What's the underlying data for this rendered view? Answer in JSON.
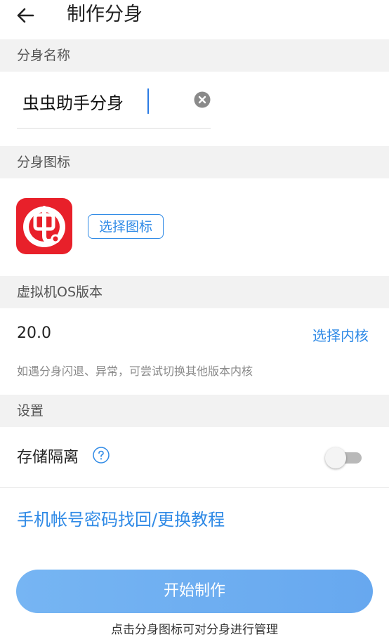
{
  "header": {
    "title": "制作分身",
    "back_icon": "arrow-left-icon"
  },
  "sections": {
    "name": "分身名称",
    "icon": "分身图标",
    "os_version": "虚拟机OS版本",
    "settings": "设置"
  },
  "name_field": {
    "value": "虫虫助手分身",
    "clear_icon": "close-circle-icon"
  },
  "icon_picker": {
    "app_icon_glyph": "虫",
    "button_label": "选择图标"
  },
  "os": {
    "version_value": "20.0",
    "choose_kernel_label": "选择内核",
    "hint": "如遇分身闪退、异常，可尝试切换其他版本内核"
  },
  "settings": {
    "storage_isolation_label": "存储隔离",
    "storage_isolation_enabled": false,
    "help_icon": "question-circle-icon"
  },
  "tutorial_link": "手机帐号密码找回/更换教程",
  "start_button": "开始制作",
  "footer_hint": "点击分身图标可对分身进行管理",
  "colors": {
    "accent": "#2f8ae6",
    "icon_red": "#e8202a",
    "section_bg": "#f2f2f2"
  }
}
